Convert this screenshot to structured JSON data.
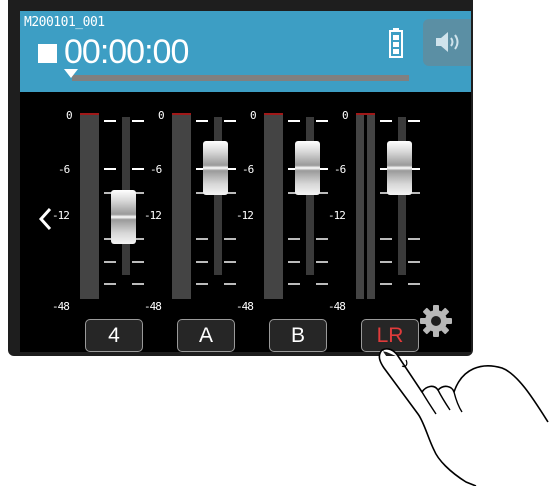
{
  "header": {
    "file_name": "M200101_001",
    "time_code": "00:00:00",
    "transport_state": "stop-icon",
    "battery_icon": "battery-full-icon",
    "speaker_icon": "speaker-icon",
    "playback_progress": 0
  },
  "mixer": {
    "back_icon": "chevron-left-icon",
    "settings_icon": "gear-icon",
    "db_scale": [
      "0",
      "-6",
      "-12",
      "-48"
    ],
    "channels": [
      {
        "label": "4",
        "selected": false,
        "fader_db": "-12"
      },
      {
        "label": "A",
        "selected": false,
        "fader_db": "-6"
      },
      {
        "label": "B",
        "selected": false,
        "fader_db": "-6"
      },
      {
        "label": "LR",
        "selected": true,
        "fader_db": "-6"
      }
    ]
  },
  "colors": {
    "header": "#3d9ec4",
    "selected_label": "#e03b3b",
    "screen_background": "#000000"
  }
}
